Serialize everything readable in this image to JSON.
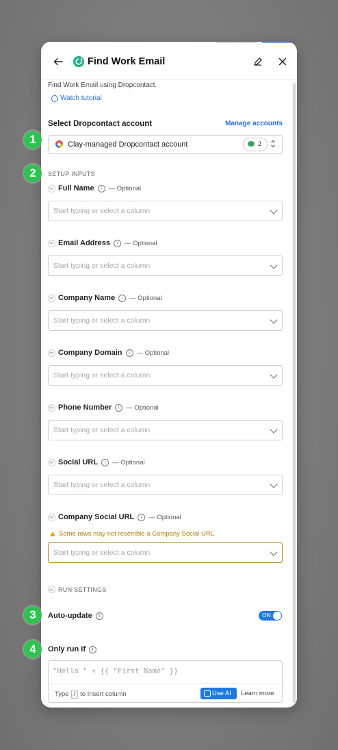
{
  "header": {
    "title": "Find Work Email"
  },
  "intro": {
    "description": "Find Work Email using Dropcontact.",
    "watch_tutorial": "Watch tutorial"
  },
  "account": {
    "section_label": "Select Dropcontact account",
    "manage_label": "Manage accounts",
    "selected": "Clay-managed Dropcontact account",
    "credits": "2"
  },
  "setup": {
    "heading": "SETUP INPUTS",
    "placeholder": "Start typing or select a column",
    "optional_label": "— Optional",
    "fields": [
      {
        "label": "Full Name"
      },
      {
        "label": "Email Address"
      },
      {
        "label": "Company Name"
      },
      {
        "label": "Company Domain"
      },
      {
        "label": "Phone Number"
      },
      {
        "label": "Social URL"
      },
      {
        "label": "Company Social URL"
      }
    ],
    "warning": "Some rows may not resemble a Company Social URL"
  },
  "run_settings": {
    "heading": "RUN SETTINGS",
    "auto_update_label": "Auto-update",
    "toggle_label": "ON",
    "only_run_if_label": "Only run if",
    "formula_placeholder": "\"Hello \" + {{ \"First Name\" }}",
    "hint_prefix": "Type",
    "hint_key": "/",
    "hint_suffix": "to Insert column",
    "use_ai_label": "Use AI",
    "learn_more_label": "Learn more"
  },
  "callouts": [
    "1",
    "2",
    "3",
    "4"
  ],
  "colors": {
    "accent": "#1f7ae0",
    "callout": "#2ec34f",
    "warning": "#b07f10"
  }
}
